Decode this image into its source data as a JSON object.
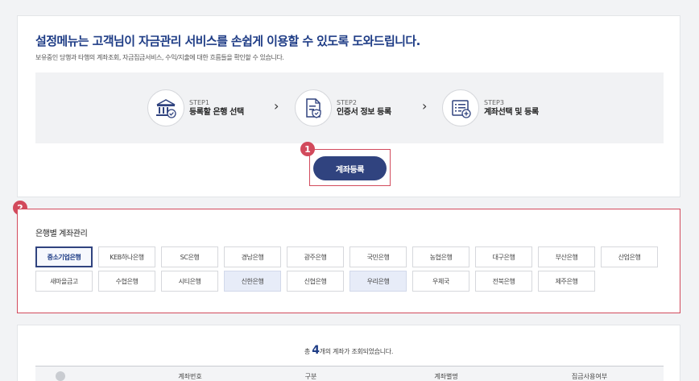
{
  "intro": {
    "title": "설정메뉴는 고객님이 자금관리 서비스를 손쉽게 이용할 수 있도록 도와드립니다.",
    "subtitle": "보유중인 당행과 타행의 계좌조회, 자금집금서비스, 수익/지출에 대한 흐름들을 확인할 수 있습니다."
  },
  "steps": [
    {
      "num": "STEP1",
      "label": "등록할 은행 선택",
      "icon": "bank-icon"
    },
    {
      "num": "STEP2",
      "label": "인증서 정보 등록",
      "icon": "certificate-icon"
    },
    {
      "num": "STEP3",
      "label": "계좌선택 및 등록",
      "icon": "account-add-icon"
    }
  ],
  "register_button": "계좌등록",
  "badges": {
    "one": "1",
    "two": "2"
  },
  "bank_section": {
    "title": "은행별 계좌관리",
    "banks": [
      "중소기업은행",
      "KEB하나은행",
      "SC은행",
      "경남은행",
      "광주은행",
      "국민은행",
      "농협은행",
      "대구은행",
      "부산은행",
      "산업은행",
      "새마을금고",
      "수협은행",
      "시티은행",
      "신한은행",
      "신협은행",
      "우리은행",
      "우체국",
      "전북은행",
      "제주은행"
    ],
    "selected": "중소기업은행",
    "highlighted": [
      "신한은행",
      "우리은행"
    ]
  },
  "accounts": {
    "summary_prefix": "총",
    "summary_count": "4",
    "summary_suffix": "개의 계좌가 조회되었습니다.",
    "columns": [
      "계좌번호",
      "구분",
      "계좌별명",
      "집금사용여부"
    ]
  },
  "colors": {
    "brand": "#30437f",
    "highlight_border": "#d24a5c"
  }
}
